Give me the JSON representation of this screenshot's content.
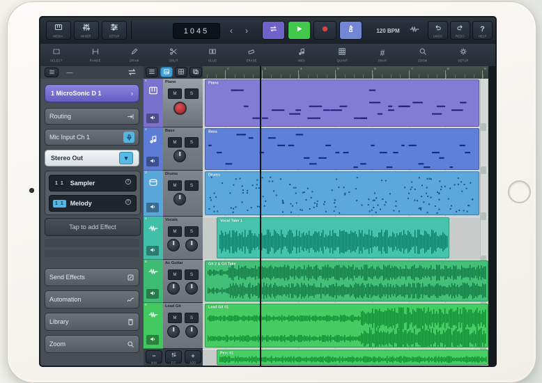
{
  "transport": {
    "position": "1045",
    "tempo": "120 BPM"
  },
  "toolbar_primary": {
    "left_buttons": [
      {
        "id": "media",
        "label": "MEDIA",
        "icon": "media"
      },
      {
        "id": "mixer",
        "label": "MIXER",
        "icon": "mixer"
      },
      {
        "id": "setup",
        "label": "SETUP",
        "icon": "setup"
      }
    ],
    "nudge_back": "‹",
    "nudge_fwd": "›",
    "transport_buttons": [
      {
        "id": "cycle",
        "icon": "cycle",
        "bg": "#6f63c9",
        "active": true
      },
      {
        "id": "play",
        "icon": "play",
        "bg": "#43c84e",
        "active": true
      },
      {
        "id": "record",
        "icon": "record",
        "bg": "#272f3a",
        "active": false
      },
      {
        "id": "metronome",
        "icon": "metronome",
        "bg": "#7187d6",
        "active": true
      }
    ],
    "right_buttons": [
      {
        "id": "undo",
        "label": "UNDO",
        "icon": "undo"
      },
      {
        "id": "redo",
        "label": "REDO",
        "icon": "redo"
      },
      {
        "id": "help",
        "label": "HELP",
        "icon": "help"
      }
    ]
  },
  "toolbar_tools": {
    "buttons": [
      {
        "id": "select",
        "label": "SELECT",
        "icon": "select"
      },
      {
        "id": "range",
        "label": "RANGE",
        "icon": "range"
      },
      {
        "id": "draw",
        "label": "DRAW",
        "icon": "draw"
      },
      {
        "id": "split",
        "label": "SPLIT",
        "icon": "split"
      },
      {
        "id": "glue",
        "label": "GLUE",
        "icon": "glue"
      },
      {
        "id": "erase",
        "label": "ERASE",
        "icon": "erase"
      },
      {
        "id": "midi",
        "label": "MIDI",
        "icon": "note"
      },
      {
        "id": "quantize",
        "label": "QUANT",
        "icon": "quant"
      },
      {
        "id": "snap",
        "label": "SNAP",
        "icon": "snap"
      },
      {
        "id": "zoom",
        "label": "ZOOM",
        "icon": "zoom"
      },
      {
        "id": "settings",
        "label": "SETUP",
        "icon": "gear"
      }
    ]
  },
  "header_row": {
    "collapse_glyph": "—",
    "loop_icon": "cycle",
    "track_header_buttons": [
      {
        "id": "list-view",
        "icon": "list",
        "active": false
      },
      {
        "id": "parts-view",
        "icon": "image",
        "active": true
      },
      {
        "id": "grid-view",
        "icon": "grid4",
        "active": false
      },
      {
        "id": "layers-view",
        "icon": "layers",
        "active": false
      }
    ]
  },
  "inspector": {
    "track_title": "1 MicroSonic D 1",
    "rows": [
      {
        "id": "routing",
        "label": "Routing",
        "icon": "routing",
        "icon_bg": ""
      },
      {
        "id": "input",
        "label": "Mic Input Ch 1",
        "icon": "input",
        "icon_bg": "#55b6e2"
      }
    ],
    "output_value": "Stereo Out",
    "midi_rows": [
      {
        "badge": "1 1",
        "label": "Sampler",
        "badge_bg": "#1b222b",
        "badge_fg": "#cfd6de"
      },
      {
        "badge": "1 1",
        "label": "Melody",
        "badge_bg": "#55b6e2",
        "badge_fg": "#10344a"
      }
    ],
    "add_effect_label": "Tap to add Effect",
    "sections": [
      {
        "label": "Send Effects",
        "icon": "fx"
      },
      {
        "label": "Automation",
        "icon": "automation"
      },
      {
        "label": "Library",
        "icon": "library"
      },
      {
        "label": "Zoom",
        "icon": "zoom"
      }
    ]
  },
  "tracks": [
    {
      "num": "1",
      "name": "Piano",
      "type": "midi",
      "strip": "#7b72cf",
      "panel": "#9aa1a8",
      "icon": "piano",
      "armed": true,
      "knobs": 0
    },
    {
      "num": "2",
      "name": "Bass",
      "type": "midi",
      "strip": "#5c7cd6",
      "panel": "#7e858d",
      "icon": "note",
      "armed": false,
      "knobs": 1
    },
    {
      "num": "3",
      "name": "Drums",
      "type": "midi",
      "strip": "#58a6da",
      "panel": "#7e858d",
      "icon": "drums",
      "armed": false,
      "knobs": 1
    },
    {
      "num": "4",
      "name": "Vocals",
      "type": "audio",
      "strip": "#42bfa9",
      "panel": "#7e858d",
      "icon": "wave",
      "armed": false,
      "knobs": 2
    },
    {
      "num": "5",
      "name": "Ac Guitar",
      "type": "audio",
      "strip": "#3fbc74",
      "panel": "#7e858d",
      "icon": "wave",
      "armed": false,
      "knobs": 2
    },
    {
      "num": "6",
      "name": "Lead Git",
      "type": "audio",
      "strip": "#41c85e",
      "panel": "#7e858d",
      "icon": "wave",
      "armed": false,
      "knobs": 2
    }
  ],
  "track_buttons": [
    "M",
    "S"
  ],
  "tracklist_footer": [
    {
      "id": "shrink",
      "glyph": "−",
      "label": "MIN"
    },
    {
      "id": "fit",
      "glyph": "updown",
      "label": "FIT"
    },
    {
      "id": "add",
      "glyph": "+",
      "label": "ADD"
    }
  ],
  "ruler": {
    "bars": [
      "2",
      "3",
      "4",
      "5",
      "6",
      "7",
      "8",
      "9"
    ]
  },
  "clips": [
    {
      "label": "Piano",
      "color": "#837bd4",
      "mark_color": "#241c7e",
      "pattern": "piano"
    },
    {
      "label": "Bass",
      "color": "#5f80d8",
      "mark_color": "#16307e",
      "pattern": "bass"
    },
    {
      "label": "Drums",
      "color": "#5ba9dc",
      "mark_color": "#1b4f94",
      "pattern": "scatter"
    },
    {
      "label": "Vocal Take 1",
      "color": "#46c3ac",
      "mark_color": "#0b7a68",
      "pattern": "wave"
    },
    {
      "label": "Git 2 & Git Take",
      "color": "#43c078",
      "mark_color": "#0c7a3c",
      "pattern": "wave"
    },
    {
      "label": "Lead Git 01",
      "color": "#45cc62",
      "mark_color": "#0b8c2e",
      "pattern": "wave"
    },
    {
      "label": "Perc 01",
      "color": "#47ce64",
      "mark_color": "#0b8c2e",
      "pattern": "wave"
    }
  ]
}
